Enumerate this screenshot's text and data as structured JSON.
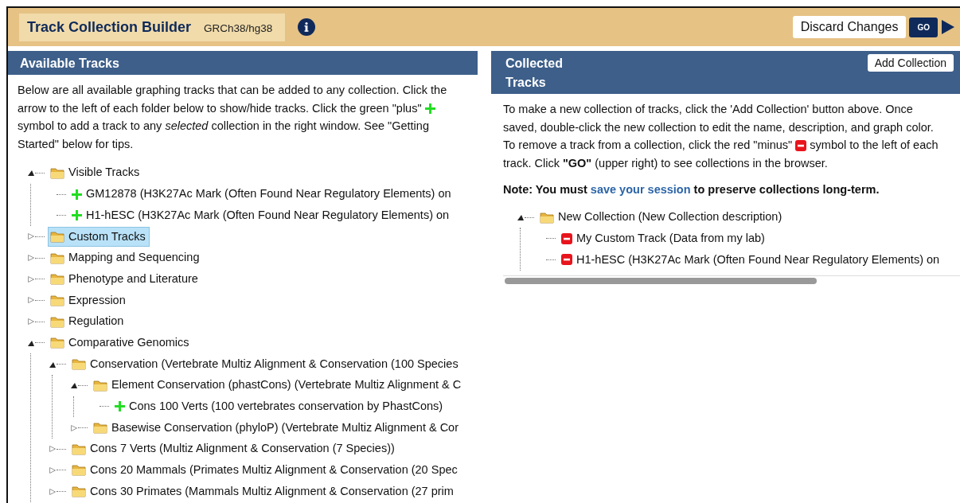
{
  "header": {
    "title": "Track Collection Builder",
    "assembly": "GRCh38/hg38",
    "discard_button": "Discard Changes",
    "go_button": "GO"
  },
  "available": {
    "title": "Available Tracks",
    "intro_before": "Below are all available graphing tracks that can be added to any collection. Click the arrow to the left of each folder below to show/hide tracks. Click the green \"plus\"",
    "intro_after": "symbol to add a track to any *selected* collection in the right window. See \"Getting Started\" below for tips.",
    "tree": [
      {
        "kind": "folder",
        "label": "Visible Tracks",
        "expanded": true,
        "selected": false,
        "children": [
          {
            "kind": "add_track",
            "label": "GM12878 (H3K27Ac Mark (Often Found Near Regulatory Elements) on",
            "selected": false
          },
          {
            "kind": "add_track",
            "label": "H1-hESC (H3K27Ac Mark (Often Found Near Regulatory Elements) on",
            "selected": false
          }
        ]
      },
      {
        "kind": "folder",
        "label": "Custom Tracks",
        "expanded": false,
        "selected": true
      },
      {
        "kind": "folder",
        "label": "Mapping and Sequencing",
        "expanded": false,
        "selected": false
      },
      {
        "kind": "folder",
        "label": "Phenotype and Literature",
        "expanded": false,
        "selected": false
      },
      {
        "kind": "folder",
        "label": "Expression",
        "expanded": false,
        "selected": false
      },
      {
        "kind": "folder",
        "label": "Regulation",
        "expanded": false,
        "selected": false
      },
      {
        "kind": "folder",
        "label": "Comparative Genomics",
        "expanded": true,
        "selected": false,
        "children": [
          {
            "kind": "folder",
            "label": "Conservation (Vertebrate Multiz Alignment & Conservation (100 Species",
            "expanded": true,
            "selected": false,
            "children": [
              {
                "kind": "folder",
                "label": "Element Conservation (phastCons) (Vertebrate Multiz Alignment & C",
                "expanded": true,
                "selected": false,
                "children": [
                  {
                    "kind": "add_track",
                    "label": "Cons 100 Verts (100 vertebrates conservation by PhastCons)",
                    "selected": false
                  }
                ]
              },
              {
                "kind": "folder",
                "label": "Basewise Conservation (phyloP) (Vertebrate Multiz Alignment & Cor",
                "expanded": false,
                "selected": false
              }
            ]
          },
          {
            "kind": "folder",
            "label": "Cons 7 Verts (Multiz Alignment & Conservation (7 Species))",
            "expanded": false,
            "selected": false
          },
          {
            "kind": "folder",
            "label": "Cons 20 Mammals (Primates Multiz Alignment & Conservation (20 Spec",
            "expanded": false,
            "selected": false
          },
          {
            "kind": "folder",
            "label": "Cons 30 Primates (Mammals Multiz Alignment & Conservation (27 prim",
            "expanded": false,
            "selected": false
          }
        ]
      }
    ]
  },
  "collected": {
    "title": "Collected Tracks",
    "add_button": "Add Collection",
    "intro_before": "To make a new collection of tracks, click the 'Add Collection' button above. Once saved, double-click the new collection to edit the name, description, and graph color. To remove a track from a collection, click the red \"minus\"",
    "intro_after": "symbol to the left of each track. Click **\"GO\"** (upper right) to see collections in the browser.",
    "note_before": "Note: You must",
    "note_link": "save your session",
    "note_after": "to preserve collections long-term.",
    "tree": [
      {
        "kind": "folder",
        "label": "New Collection (New Collection description)",
        "expanded": true,
        "selected": false,
        "children": [
          {
            "kind": "remove_track",
            "label": "My Custom Track (Data from my lab)",
            "selected": false
          },
          {
            "kind": "remove_track",
            "label": "H1-hESC (H3K27Ac Mark (Often Found Near Regulatory Elements) on",
            "selected": false
          }
        ]
      }
    ]
  }
}
